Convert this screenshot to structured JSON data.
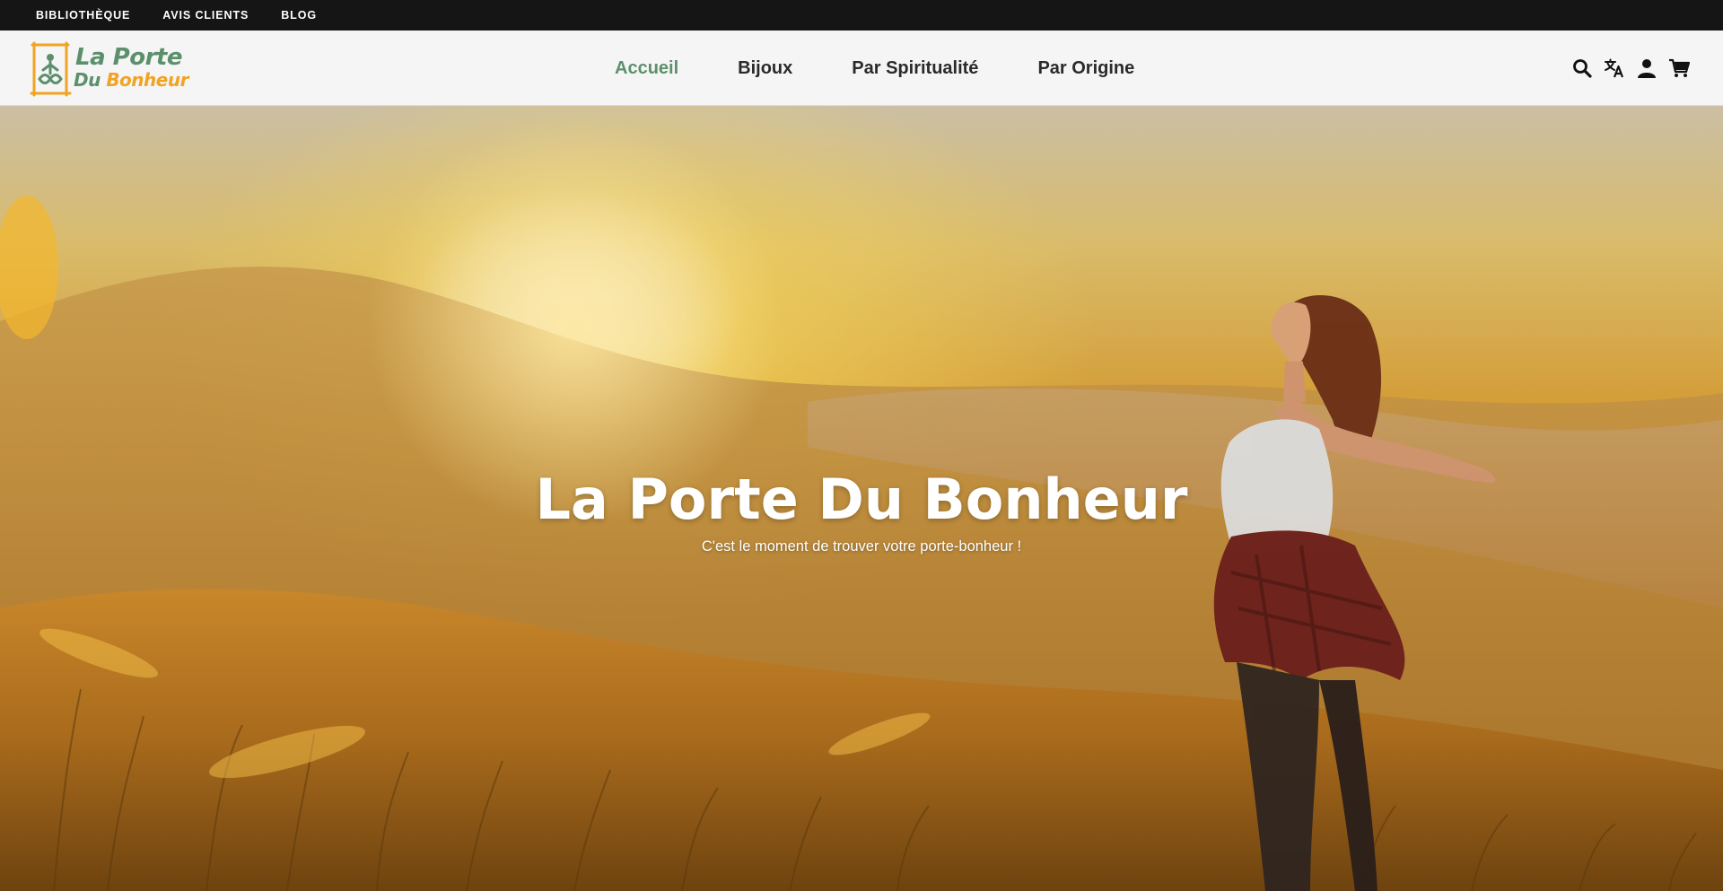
{
  "topbar": {
    "links": [
      "BIBLIOTHÈQUE",
      "AVIS CLIENTS",
      "BLOG"
    ]
  },
  "header": {
    "logo": {
      "line1": "La Porte",
      "line2_a": "Du",
      "line2_b": "Bonheur"
    },
    "nav": [
      "Accueil",
      "Bijoux",
      "Par Spiritualité",
      "Par Origine"
    ],
    "active_nav": "Accueil",
    "icons": [
      "search-icon",
      "translate-icon",
      "account-icon",
      "cart-icon"
    ]
  },
  "hero": {
    "title": "La Porte Du Bonheur",
    "subtitle": "C'est le moment de trouver votre porte-bonheur !"
  },
  "colors": {
    "accent_green": "#5c8f6c",
    "logo_orange": "#f1a324",
    "topbar_bg": "#151515",
    "header_bg": "#f5f5f5"
  }
}
